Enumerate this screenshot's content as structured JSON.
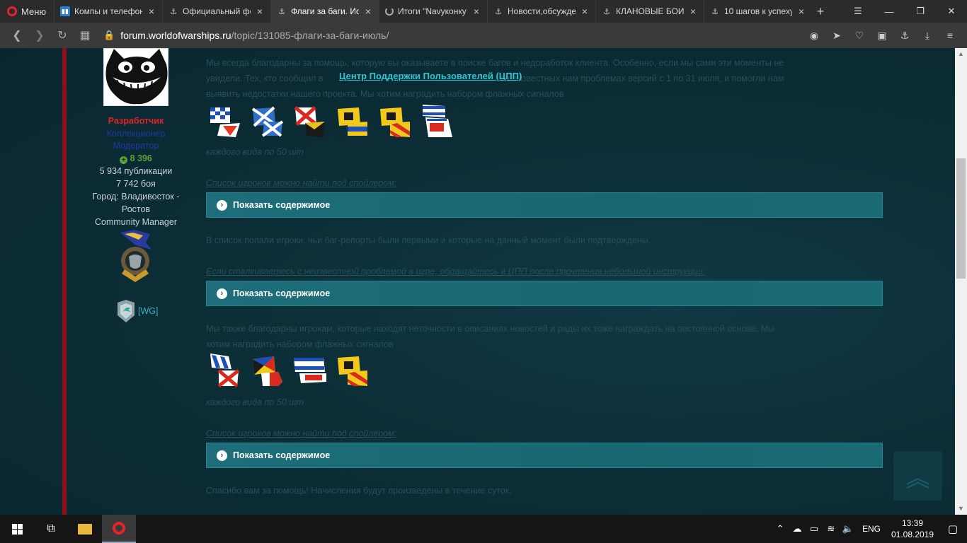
{
  "browser": {
    "menu_label": "Меню",
    "tabs": [
      {
        "title": "Компы и телефон",
        "favicon": "trello-icon"
      },
      {
        "title": "Официальный фо",
        "favicon": "wows-icon"
      },
      {
        "title": "Флаги за баги. Ио",
        "favicon": "wows-icon",
        "active": true
      },
      {
        "title": "Итоги \"Navyконку",
        "favicon": "loading-spinner-icon"
      },
      {
        "title": "Новости,обсужде",
        "favicon": "wows-icon"
      },
      {
        "title": "КЛАНОВЫЕ БОИ",
        "favicon": "wows-icon"
      },
      {
        "title": "10 шагов к успеху",
        "favicon": "wows-icon"
      }
    ],
    "new_tab": "+",
    "url_domain": "forum.worldofwarships.ru",
    "url_path": "/topic/131085-флаги-за-баги-июль/",
    "url_prefix": ""
  },
  "author": {
    "rank_developer": "Разработчик",
    "rank_collector": "Коллекционер",
    "rank_moderator": "Модератор",
    "reputation": "8 396",
    "posts": "5 934 публикации",
    "battles": "7 742 боя",
    "city_line1": "Город: Владивосток -",
    "city_line2": "Ростов",
    "title": "Community Manager",
    "clan_tag": "[WG]"
  },
  "post": {
    "p1_line1": "Мы всегда благодарны за помощь, которую вы оказываете в поиске багов и недоработок клиента. Особенно, если мы сами эти моменты не",
    "p1_line2": "увидели. Тех, кто сообщил в",
    "p1_line2_after": "о неизвестных нам проблемах версий с 1 по 31 июля, и помогли нам",
    "p1_line3": "выявить недостатки нашего проекта. Мы хотим наградить набором флажных сигналов",
    "cpp_link": "Центр Поддержки Пользователей (ЦПП)",
    "flags_note_1": "каждого вида по 50 шт",
    "spoiler_intro_1": "Список игроков можно найти под спойлером:",
    "spoiler_label": "Показать содержимое",
    "p2": "В список попали игроки, чьи баг-репорты были первыми и которые на данный момент были подтверждены.",
    "p3": "Если сталкиваетесь с неизвестной проблемой в игре, обращайтесь в ЦПП после прочтения небольшой инструкции.",
    "p4_line1": "Мы также благодарны игрокам, которые находят неточности в описаниях новостей и рады их тоже награждать на постоянной основе. Мы",
    "p4_line2": "хотим наградить набором флажных сигналов",
    "flags_note_2": "каждого вида по 50 шт",
    "spoiler_intro_2": "Список игроков можно найти под спойлером:",
    "p5": "Спасибо вам за помощь! Начисления будут произведены в течение суток."
  },
  "taskbar": {
    "lang": "ENG",
    "time": "13:39",
    "date": "01.08.2019"
  },
  "colors": {
    "accent_teal": "#2fc6d2",
    "spoiler_bg": "#196772",
    "developer_red": "#e0222a",
    "reputation_green": "#5ea03a"
  }
}
